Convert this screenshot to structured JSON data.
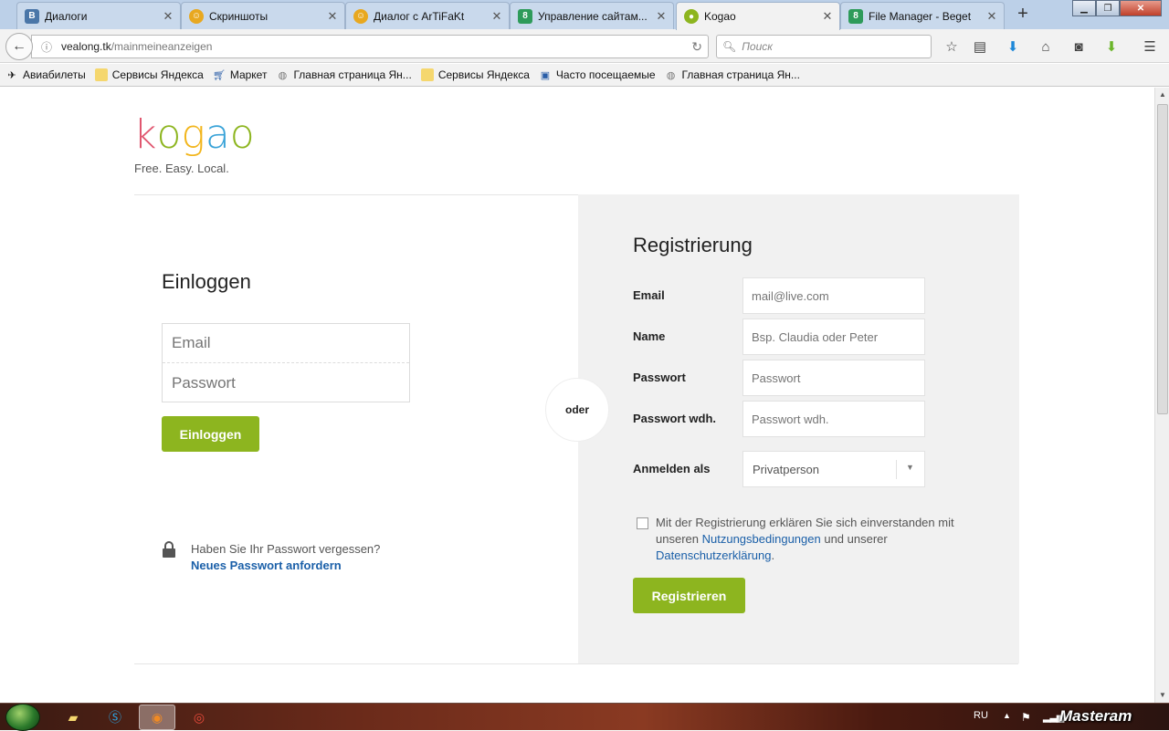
{
  "browser": {
    "tabs": [
      {
        "title": "Диалоги",
        "favicon": "vk-icon",
        "color": "#4a76a8"
      },
      {
        "title": "Скриншоты",
        "favicon": "smiley-icon",
        "color": "#e8a820"
      },
      {
        "title": "Диалог с ArTiFaKt",
        "favicon": "smiley-icon",
        "color": "#e8a820"
      },
      {
        "title": "Управление сайтам...",
        "favicon": "beget-icon",
        "color": "#2e9b5a"
      },
      {
        "title": "Kogao",
        "favicon": "lock-icon",
        "color": "#8db51f"
      },
      {
        "title": "File Manager - Beget",
        "favicon": "beget-icon",
        "color": "#2e9b5a"
      }
    ],
    "url_domain": "vealong.tk",
    "url_path": "/mainmeineanzeigen",
    "search_placeholder": "Поиск",
    "bookmarks": [
      {
        "label": "Авиабилеты",
        "icon": "plane-icon"
      },
      {
        "label": "Сервисы Яндекса",
        "icon": "folder-icon"
      },
      {
        "label": "Маркет",
        "icon": "cart-icon"
      },
      {
        "label": "Главная страница Ян...",
        "icon": "globe-icon"
      },
      {
        "label": "Сервисы Яндекса",
        "icon": "folder-icon"
      },
      {
        "label": "Часто посещаемые",
        "icon": "bookmark-list-icon"
      },
      {
        "label": "Главная страница Ян...",
        "icon": "globe-icon"
      }
    ]
  },
  "page": {
    "logo_letters": [
      {
        "char": "k",
        "color": "#e0566f"
      },
      {
        "char": "o",
        "color": "#8db51f"
      },
      {
        "char": "g",
        "color": "#f2b51b"
      },
      {
        "char": "a",
        "color": "#3aa3d8"
      },
      {
        "char": "o",
        "color": "#8db51f"
      }
    ],
    "tagline": "Free. Easy. Local.",
    "accent_color": "#8db51f",
    "link_color": "#1a5fa8",
    "login": {
      "title": "Einloggen",
      "email_placeholder": "Email",
      "password_placeholder": "Passwort",
      "button": "Einloggen",
      "forgot_text": "Haben Sie Ihr Passwort vergessen?",
      "forgot_link": "Neues Passwort anfordern"
    },
    "divider": "oder",
    "register": {
      "title": "Registrierung",
      "email_label": "Email",
      "email_placeholder": "mail@live.com",
      "name_label": "Name",
      "name_placeholder": "Bsp. Claudia oder Peter",
      "password_label": "Passwort",
      "password_placeholder": "Passwort",
      "password_repeat_label": "Passwort wdh.",
      "password_repeat_placeholder": "Passwort wdh.",
      "account_type_label": "Anmelden als",
      "account_type_value": "Privatperson",
      "agree_prefix": "Mit der Registrierung erklären Sie sich einverstanden mit unseren",
      "terms_link": "Nutzungsbedingungen",
      "agree_middle": "und unserer",
      "privacy_link": "Datenschutzerklärung",
      "agree_suffix": ".",
      "button": "Registrieren"
    }
  },
  "taskbar": {
    "language": "RU",
    "watermark": "Masteram"
  }
}
